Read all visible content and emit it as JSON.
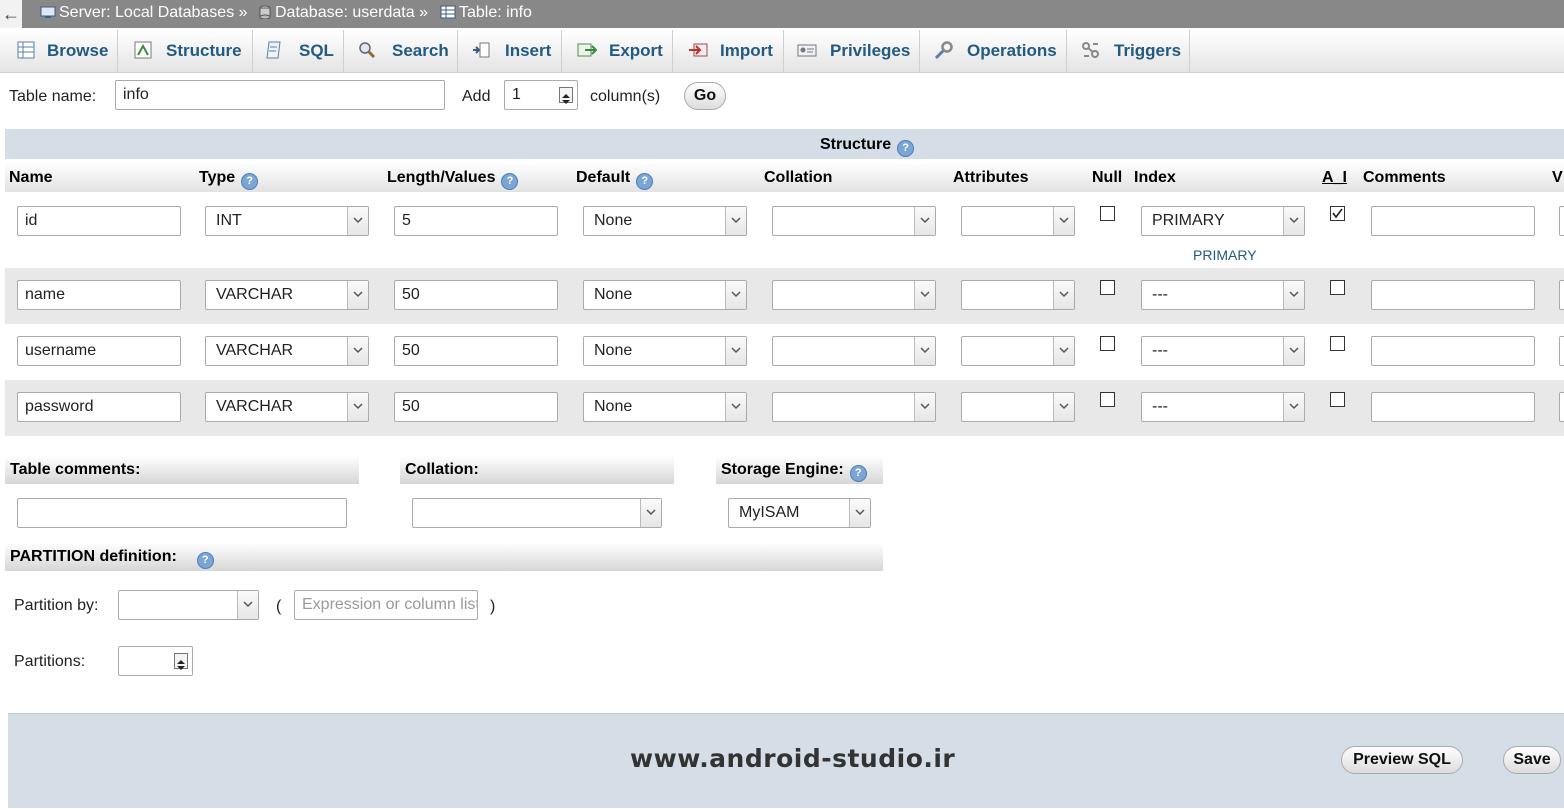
{
  "breadcrumb": {
    "back": "←",
    "server": "Server: Local Databases",
    "database": "Database: userdata",
    "table": "Table: info",
    "separator": "»"
  },
  "tabs": [
    {
      "label": "Browse",
      "icon": "browse-icon"
    },
    {
      "label": "Structure",
      "icon": "structure-icon"
    },
    {
      "label": "SQL",
      "icon": "sql-icon"
    },
    {
      "label": "Search",
      "icon": "search-icon"
    },
    {
      "label": "Insert",
      "icon": "insert-icon"
    },
    {
      "label": "Export",
      "icon": "export-icon"
    },
    {
      "label": "Import",
      "icon": "import-icon"
    },
    {
      "label": "Privileges",
      "icon": "privileges-icon"
    },
    {
      "label": "Operations",
      "icon": "operations-icon"
    },
    {
      "label": "Triggers",
      "icon": "triggers-icon"
    }
  ],
  "tablename": {
    "label": "Table name:",
    "value": "info",
    "add_label": "Add",
    "add_value": "1",
    "columns_label": "column(s)",
    "go_label": "Go"
  },
  "structure": {
    "title": "Structure",
    "headers": {
      "name": "Name",
      "type": "Type",
      "length": "Length/Values",
      "default": "Default",
      "collation": "Collation",
      "attributes": "Attributes",
      "null": "Null",
      "index": "Index",
      "ai": "A_I",
      "comments": "Comments",
      "virtuality": "V"
    },
    "rows": [
      {
        "name": "id",
        "type": "INT",
        "length": "5",
        "default": "None",
        "collation": "",
        "attributes": "",
        "null": false,
        "index": "PRIMARY",
        "index_note": "PRIMARY",
        "ai": true,
        "comments": ""
      },
      {
        "name": "name",
        "type": "VARCHAR",
        "length": "50",
        "default": "None",
        "collation": "",
        "attributes": "",
        "null": false,
        "index": "---",
        "ai": false,
        "comments": ""
      },
      {
        "name": "username",
        "type": "VARCHAR",
        "length": "50",
        "default": "None",
        "collation": "",
        "attributes": "",
        "null": false,
        "index": "---",
        "ai": false,
        "comments": ""
      },
      {
        "name": "password",
        "type": "VARCHAR",
        "length": "50",
        "default": "None",
        "collation": "",
        "attributes": "",
        "null": false,
        "index": "---",
        "ai": false,
        "comments": ""
      }
    ]
  },
  "table_options": {
    "comments_label": "Table comments:",
    "comments_value": "",
    "collation_label": "Collation:",
    "collation_value": "",
    "engine_label": "Storage Engine:",
    "engine_value": "MyISAM"
  },
  "partition": {
    "title": "PARTITION definition:",
    "by_label": "Partition by:",
    "by_value": "",
    "open_paren": "(",
    "expression_placeholder": "Expression or column list",
    "close_paren": ")",
    "partitions_label": "Partitions:",
    "partitions_value": ""
  },
  "footer": {
    "watermark": "www.android-studio.ir",
    "preview_label": "Preview SQL",
    "save_label": "Save"
  },
  "colors": {
    "tab_text": "#235a81",
    "help_icon": "#7ba5d2",
    "footer_bg": "#d5dee7"
  }
}
